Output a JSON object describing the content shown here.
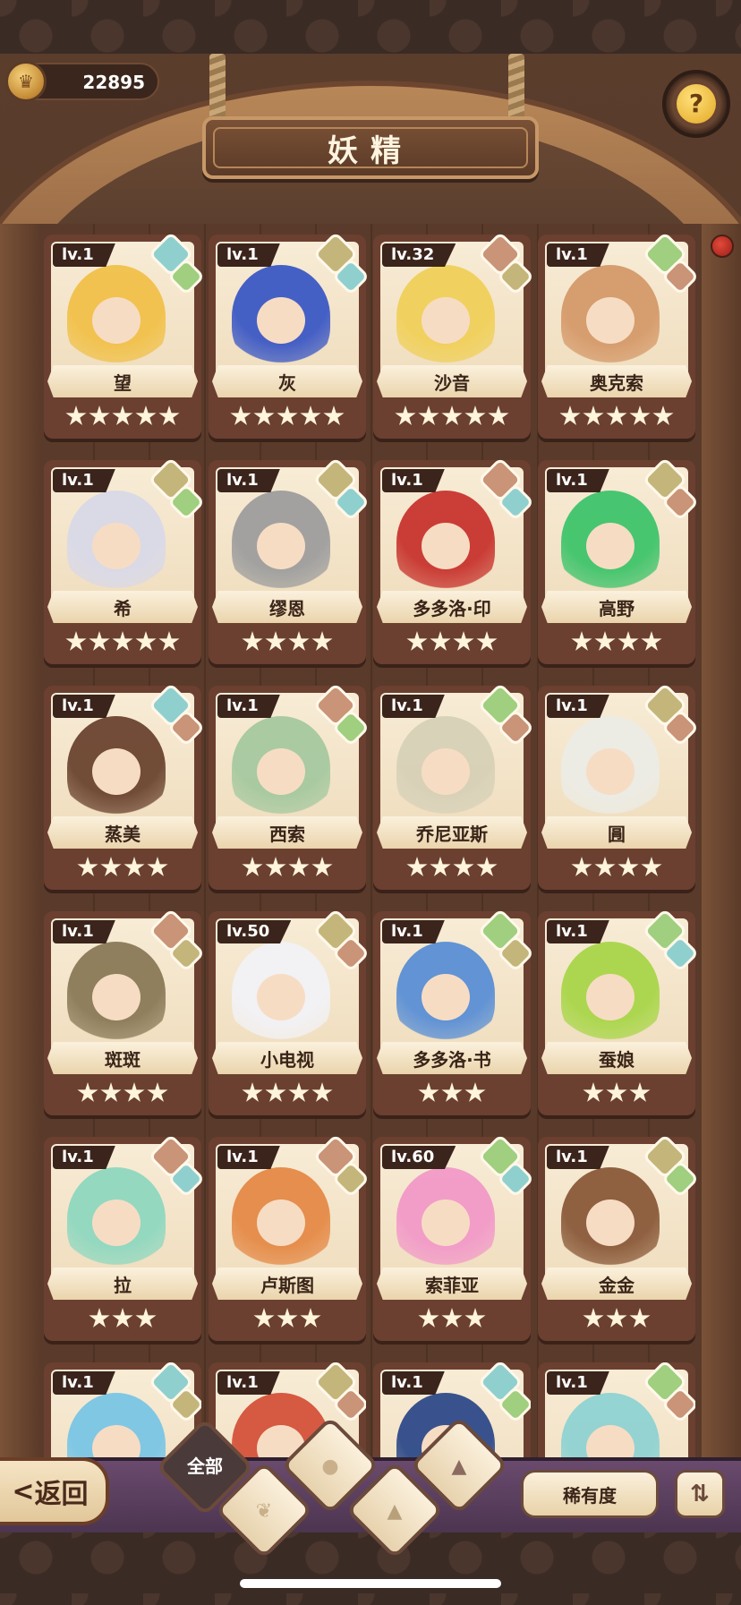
{
  "header": {
    "title": "妖精",
    "currency_value": "22895",
    "help_symbol": "?"
  },
  "fairies": [
    {
      "name": "望",
      "level": "lv.1",
      "stars": 5,
      "elements": [
        "water",
        "leaf"
      ],
      "color": "#f1c14a"
    },
    {
      "name": "灰",
      "level": "lv.1",
      "stars": 5,
      "elements": [
        "earth",
        "water"
      ],
      "color": "#3c59c5"
    },
    {
      "name": "沙音",
      "level": "lv.32",
      "stars": 5,
      "elements": [
        "fire",
        "earth"
      ],
      "color": "#f0d05a"
    },
    {
      "name": "奥克索",
      "level": "lv.1",
      "stars": 5,
      "elements": [
        "leaf",
        "fire"
      ],
      "color": "#d59a6a"
    },
    {
      "name": "希",
      "level": "lv.1",
      "stars": 5,
      "elements": [
        "earth",
        "leaf"
      ],
      "color": "#d9d9e8"
    },
    {
      "name": "缪恩",
      "level": "lv.1",
      "stars": 4,
      "elements": [
        "earth",
        "water"
      ],
      "color": "#9e9e9e"
    },
    {
      "name": "多多洛·印",
      "level": "lv.1",
      "stars": 4,
      "elements": [
        "fire",
        "water"
      ],
      "color": "#c8352f"
    },
    {
      "name": "高野",
      "level": "lv.1",
      "stars": 4,
      "elements": [
        "earth",
        "fire"
      ],
      "color": "#3fc46b"
    },
    {
      "name": "蒸美",
      "level": "lv.1",
      "stars": 4,
      "elements": [
        "water",
        "fire"
      ],
      "color": "#6b4430"
    },
    {
      "name": "西索",
      "level": "lv.1",
      "stars": 4,
      "elements": [
        "fire",
        "leaf"
      ],
      "color": "#a6c9a0"
    },
    {
      "name": "乔尼亚斯",
      "level": "lv.1",
      "stars": 4,
      "elements": [
        "leaf",
        "fire"
      ],
      "color": "#d7d1b8"
    },
    {
      "name": "㘣",
      "level": "lv.1",
      "stars": 4,
      "elements": [
        "earth",
        "fire"
      ],
      "color": "#ecece6"
    },
    {
      "name": "斑斑",
      "level": "lv.1",
      "stars": 4,
      "elements": [
        "fire",
        "earth"
      ],
      "color": "#8a7a58"
    },
    {
      "name": "小电视",
      "level": "lv.50",
      "stars": 4,
      "elements": [
        "earth",
        "fire"
      ],
      "color": "#f2f2f6"
    },
    {
      "name": "多多洛·书",
      "level": "lv.1",
      "stars": 3,
      "elements": [
        "leaf",
        "earth"
      ],
      "color": "#5a8fd6"
    },
    {
      "name": "蚕娘",
      "level": "lv.1",
      "stars": 3,
      "elements": [
        "leaf",
        "water"
      ],
      "color": "#a9d64a"
    },
    {
      "name": "拉",
      "level": "lv.1",
      "stars": 3,
      "elements": [
        "fire",
        "water"
      ],
      "color": "#8fd8c0"
    },
    {
      "name": "卢斯图",
      "level": "lv.1",
      "stars": 3,
      "elements": [
        "fire",
        "earth"
      ],
      "color": "#e58a47"
    },
    {
      "name": "索菲亚",
      "level": "lv.60",
      "stars": 3,
      "elements": [
        "leaf",
        "water"
      ],
      "color": "#f29ac8"
    },
    {
      "name": "金金",
      "level": "lv.1",
      "stars": 3,
      "elements": [
        "earth",
        "leaf"
      ],
      "color": "#8a5a3a"
    },
    {
      "name": "",
      "level": "lv.1",
      "stars": 0,
      "elements": [
        "water",
        "earth"
      ],
      "color": "#7ac6e6"
    },
    {
      "name": "",
      "level": "lv.1",
      "stars": 0,
      "elements": [
        "earth",
        "fire"
      ],
      "color": "#d5523a"
    },
    {
      "name": "",
      "level": "lv.1",
      "stars": 0,
      "elements": [
        "water",
        "leaf"
      ],
      "color": "#2f4b8a"
    },
    {
      "name": "",
      "level": "lv.1",
      "stars": 0,
      "elements": [
        "leaf",
        "fire"
      ],
      "color": "#8fd3d3"
    }
  ],
  "bottom": {
    "back_label": "返回",
    "back_arrow": "<",
    "filter_all_label": "全部",
    "filter_tabs": [
      "all-tab",
      "leaf-tab",
      "water-tab",
      "earth-tab",
      "fire-tab"
    ],
    "rarity_label": "稀有度",
    "sort_icon": "sort-icon"
  }
}
